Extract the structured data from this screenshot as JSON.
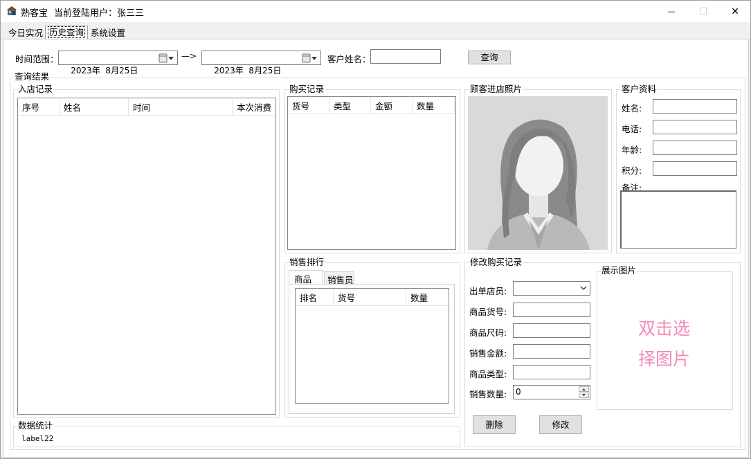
{
  "titlebar": {
    "app_name": "熟客宝",
    "user_label": "当前登陆用户：张三三",
    "minimize": "—",
    "maximize": "☐",
    "close": "✕"
  },
  "tabs": [
    "今日实况",
    "历史查询",
    "系统设置"
  ],
  "active_tab": "历史查询",
  "query": {
    "range_label": "时间范围：",
    "start_date": "2023年  8月25日",
    "arrow": "—>",
    "end_date": "2023年  8月25日",
    "customer_label": "客户姓名：",
    "customer_value": "",
    "query_button": "查询"
  },
  "results": {
    "title": "查询结果",
    "visits": {
      "title": "入店记录",
      "columns": [
        "序号",
        "姓名",
        "时间",
        "本次消费"
      ]
    },
    "purchases": {
      "title": "购买记录",
      "columns": [
        "货号",
        "类型",
        "金额",
        "数量"
      ]
    },
    "photo": {
      "title": "顾客进店照片"
    },
    "customer": {
      "title": "客户资料",
      "name_label": "姓名:",
      "phone_label": "电话:",
      "age_label": "年龄:",
      "points_label": "积分:",
      "note_label": "备注:"
    },
    "ranking": {
      "title": "销售排行",
      "tabs": [
        "商品",
        "销售员"
      ],
      "columns": [
        "排名",
        "货号",
        "数量"
      ]
    },
    "edit": {
      "title": "修改购买记录",
      "clerk_label": "出单店员:",
      "sku_label": "商品货号:",
      "size_label": "商品尺码:",
      "amount_label": "销售金额:",
      "type_label": "商品类型:",
      "qty_label": "销售数量:",
      "qty_value": "0",
      "delete_button": "删除",
      "modify_button": "修改"
    },
    "preview": {
      "title": "展示图片",
      "line1": "双击选",
      "line2": "择图片"
    },
    "stats": {
      "title": "数据统计",
      "value": "label22"
    }
  },
  "colors": {
    "accent_text": "#f28ab5",
    "panel_bg": "#ffffff",
    "window_bg": "#f0f0f0"
  }
}
